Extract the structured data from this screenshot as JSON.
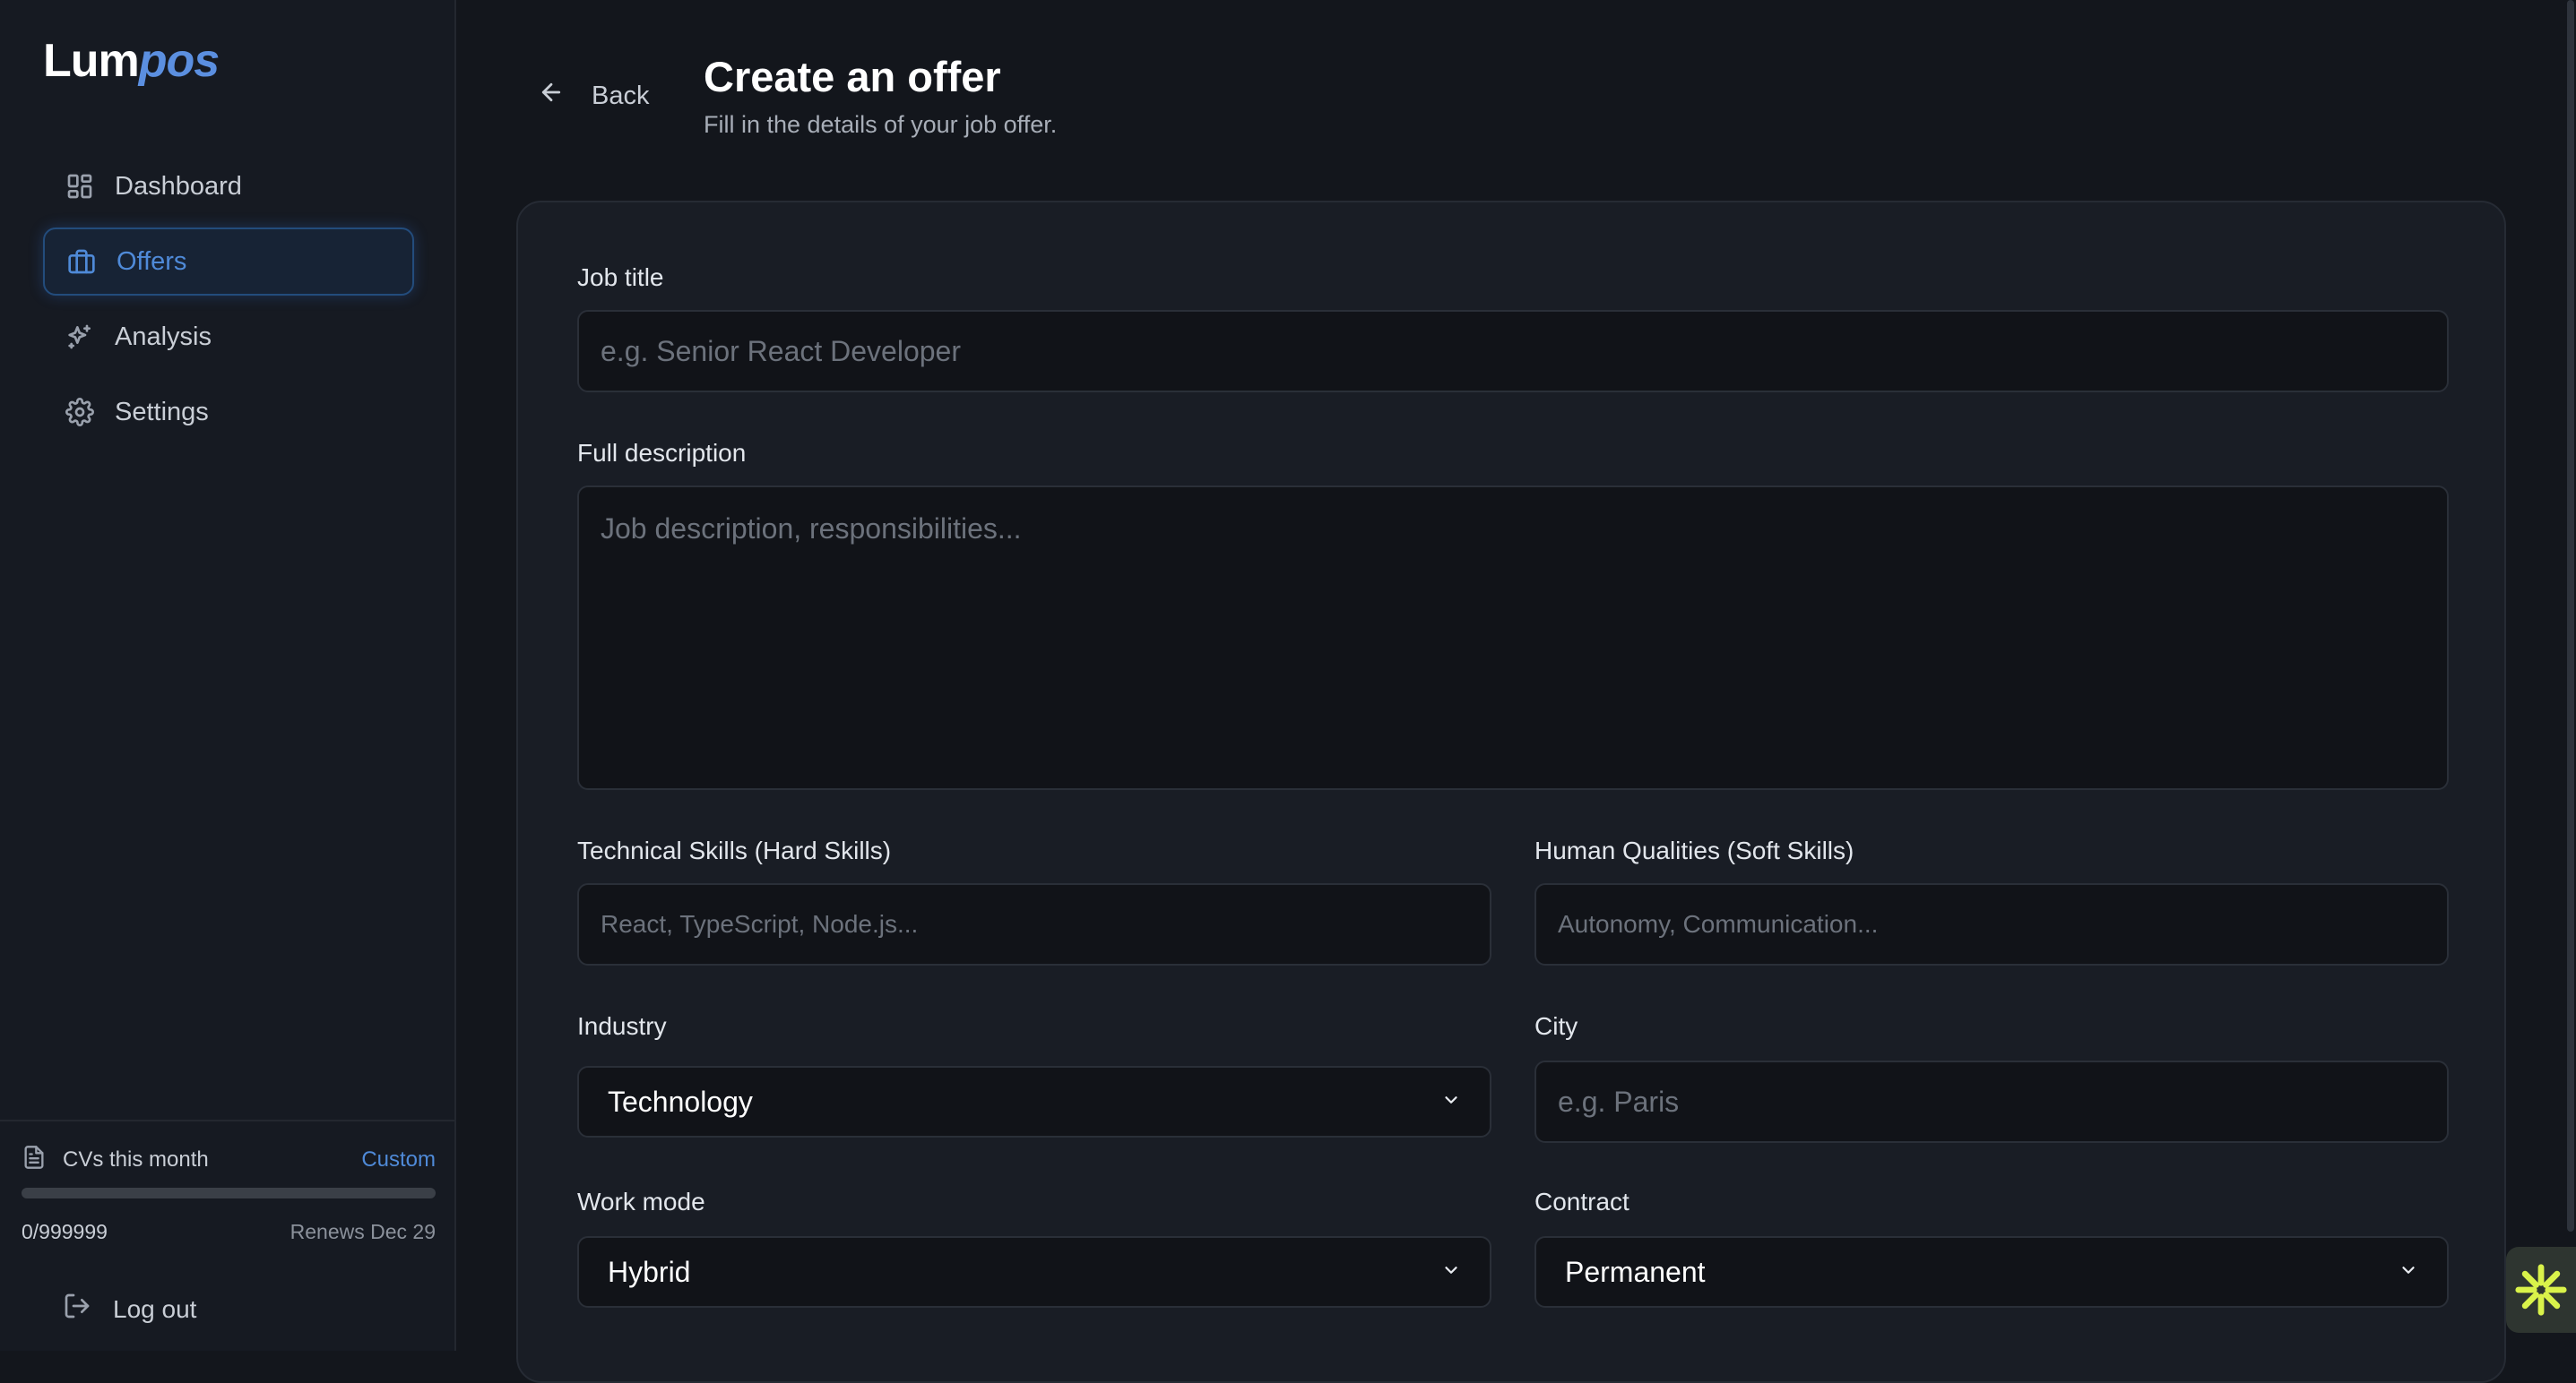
{
  "brand": {
    "part1": "Lum",
    "part2": "pos"
  },
  "sidebar": {
    "items": [
      {
        "label": "Dashboard",
        "icon": "dashboard-icon",
        "active": false
      },
      {
        "label": "Offers",
        "icon": "briefcase-icon",
        "active": true
      },
      {
        "label": "Analysis",
        "icon": "sparkles-icon",
        "active": false
      },
      {
        "label": "Settings",
        "icon": "gear-icon",
        "active": false
      }
    ],
    "usage": {
      "label": "CVs this month",
      "plan": "Custom",
      "count": "0/999999",
      "renews": "Renews Dec 29",
      "progress_fraction": 0
    },
    "logout_label": "Log out"
  },
  "header": {
    "back_label": "Back",
    "title": "Create an offer",
    "subtitle": "Fill in the details of your job offer."
  },
  "form": {
    "job_title": {
      "label": "Job title",
      "placeholder": "e.g. Senior React Developer",
      "value": ""
    },
    "description": {
      "label": "Full description",
      "placeholder": "Job description, responsibilities...",
      "value": ""
    },
    "hard_skills": {
      "label": "Technical Skills (Hard Skills)",
      "placeholder": "React, TypeScript, Node.js...",
      "value": ""
    },
    "soft_skills": {
      "label": "Human Qualities (Soft Skills)",
      "placeholder": "Autonomy, Communication...",
      "value": ""
    },
    "industry": {
      "label": "Industry",
      "value": "Technology"
    },
    "city": {
      "label": "City",
      "placeholder": "e.g. Paris",
      "value": ""
    },
    "work_mode": {
      "label": "Work mode",
      "value": "Hybrid"
    },
    "contract": {
      "label": "Contract",
      "value": "Permanent"
    }
  },
  "colors": {
    "accent": "#4f8ad8",
    "background": "#13161c",
    "card": "#191d25",
    "fab_icon": "#d9f24a"
  }
}
